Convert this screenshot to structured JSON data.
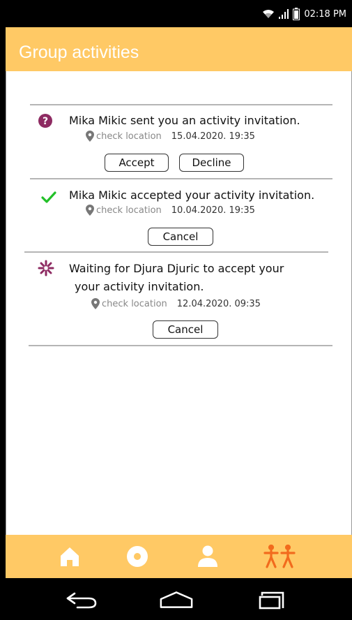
{
  "status_bar": {
    "time": "02:18 PM",
    "icons": [
      "wifi-icon",
      "signal-icon",
      "battery-icon"
    ]
  },
  "app_bar": {
    "title": "Group activities",
    "color": "#ffc965"
  },
  "activities": [
    {
      "status": "question-icon",
      "message": "Mika Mikic sent you an activity invitation.",
      "location_label": "check location",
      "datetime": "15.04.2020. 19:35",
      "accept_label": "Accept",
      "decline_label": "Decline"
    },
    {
      "status": "checkmark-icon",
      "message": "Mika Mikic accepted your activity invitation.",
      "location_label": "check location",
      "datetime": "10.04.2020. 19:35",
      "cancel_label": "Cancel"
    },
    {
      "status": "pending-icon",
      "message_line1": "Waiting for Djura Djuric to accept your",
      "message_line2": "your activity invitation.",
      "location_label": "check location",
      "datetime": "12.04.2020. 09:35",
      "cancel_label": "Cancel"
    }
  ],
  "bottom_nav": {
    "items": [
      "home-icon",
      "circle-icon",
      "person-icon",
      "group-activities-icon"
    ],
    "active_color": "#f26b1d",
    "inactive_color": "#ffffff"
  },
  "system_nav": [
    "back-icon",
    "home-button-icon",
    "recent-apps-icon"
  ]
}
